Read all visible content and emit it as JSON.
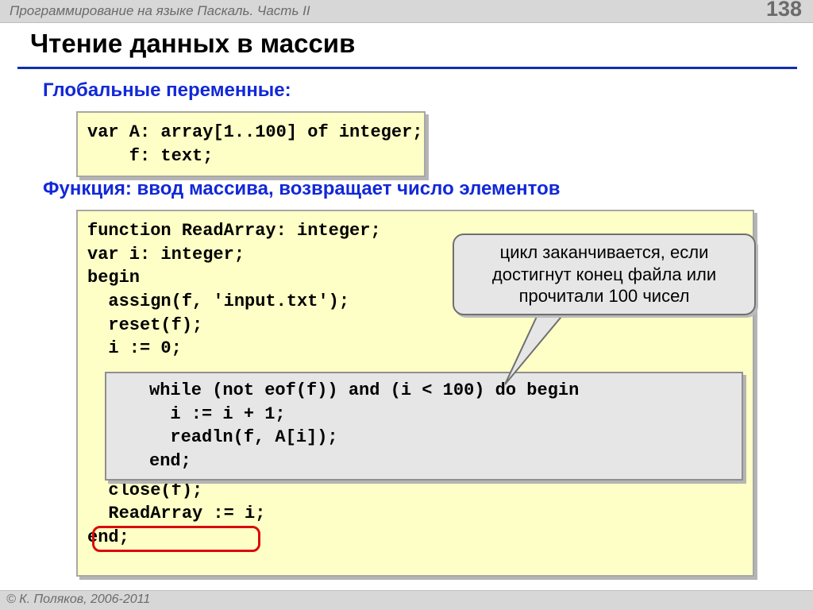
{
  "header": {
    "breadcrumb": "Программирование на языке Паскаль. Часть II",
    "page": "138"
  },
  "title": "Чтение данных в массив",
  "sections": {
    "globals_heading": "Глобальные переменные:",
    "function_heading": "Функция: ввод массива, возвращает число элементов"
  },
  "code": {
    "globals": "var A: array[1..100] of integer;\n    f: text;",
    "func_body": "function ReadArray: integer;\nvar i: integer;\nbegin\n  assign(f, 'input.txt');\n  reset(f);\n  i := 0;\n\n\n\n\n\n  close(f);\n  ReadArray := i;\nend;",
    "while_block": "while (not eof(f)) and (i < 100) do begin\n  i := i + 1;\n  readln(f, A[i]);\nend;"
  },
  "callout": {
    "text": "цикл заканчивается, если достигнут конец файла или прочитали 100 чисел"
  },
  "footer": {
    "copyright": "© К. Поляков, 2006-2011"
  }
}
